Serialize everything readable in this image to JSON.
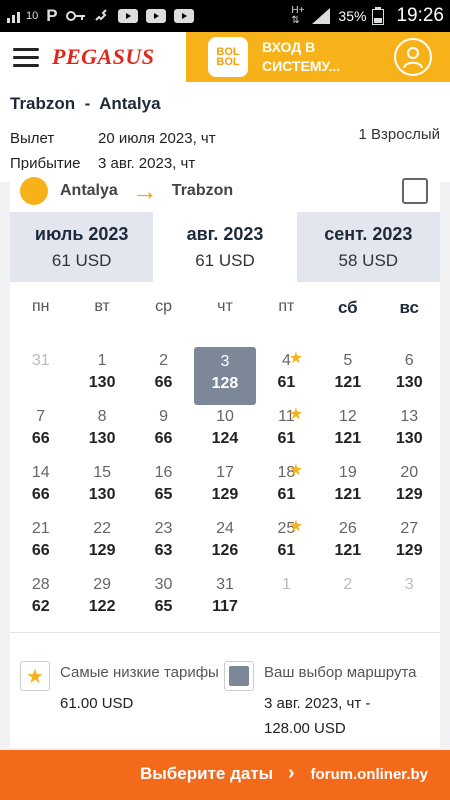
{
  "status_bar": {
    "left_icons": [
      "signal-10-icon",
      "p-icon",
      "key-icon",
      "call-icon",
      "youtube-icon",
      "youtube-icon",
      "youtube-icon"
    ],
    "signal_label": "10",
    "battery_pct": "35%",
    "time": "19:26"
  },
  "header": {
    "brand": "PEGASUS",
    "bolbol_line1": "BOL",
    "bolbol_line2": "BOL",
    "login_line1": "ВХОД В",
    "login_line2": "СИСТЕМУ..."
  },
  "trip": {
    "from": "Trabzon",
    "to": "Antalya",
    "dep_label": "Вылет",
    "dep_value": "20 июля 2023, чт",
    "arr_label": "Прибытие",
    "arr_value": "3 авг. 2023, чт",
    "passengers": "1 Взрослый"
  },
  "card_header": {
    "from": "Antalya",
    "to": "Trabzon"
  },
  "months": [
    {
      "name": "июль 2023",
      "price": "61 USD",
      "active": false
    },
    {
      "name": "авг. 2023",
      "price": "61 USD",
      "active": true
    },
    {
      "name": "сент. 2023",
      "price": "58 USD",
      "active": false
    }
  ],
  "weekdays": [
    "пн",
    "вт",
    "ср",
    "чт",
    "пт",
    "сб",
    "вс"
  ],
  "calendar": [
    [
      {
        "n": "31",
        "p": "",
        "muted": true
      },
      {
        "n": "1",
        "p": "130"
      },
      {
        "n": "2",
        "p": "66"
      },
      {
        "n": "3",
        "p": "128",
        "selected": true
      },
      {
        "n": "4",
        "p": "61",
        "star": true
      },
      {
        "n": "5",
        "p": "121"
      },
      {
        "n": "6",
        "p": "130"
      }
    ],
    [
      {
        "n": "7",
        "p": "66"
      },
      {
        "n": "8",
        "p": "130"
      },
      {
        "n": "9",
        "p": "66"
      },
      {
        "n": "10",
        "p": "124"
      },
      {
        "n": "11",
        "p": "61",
        "star": true
      },
      {
        "n": "12",
        "p": "121"
      },
      {
        "n": "13",
        "p": "130"
      }
    ],
    [
      {
        "n": "14",
        "p": "66"
      },
      {
        "n": "15",
        "p": "130"
      },
      {
        "n": "16",
        "p": "65"
      },
      {
        "n": "17",
        "p": "129"
      },
      {
        "n": "18",
        "p": "61",
        "star": true
      },
      {
        "n": "19",
        "p": "121"
      },
      {
        "n": "20",
        "p": "129"
      }
    ],
    [
      {
        "n": "21",
        "p": "66"
      },
      {
        "n": "22",
        "p": "129"
      },
      {
        "n": "23",
        "p": "63"
      },
      {
        "n": "24",
        "p": "126"
      },
      {
        "n": "25",
        "p": "61",
        "star": true
      },
      {
        "n": "26",
        "p": "121"
      },
      {
        "n": "27",
        "p": "129"
      }
    ],
    [
      {
        "n": "28",
        "p": "62"
      },
      {
        "n": "29",
        "p": "122"
      },
      {
        "n": "30",
        "p": "65"
      },
      {
        "n": "31",
        "p": "117"
      },
      {
        "n": "1",
        "p": "",
        "muted": true
      },
      {
        "n": "2",
        "p": "",
        "muted": true
      },
      {
        "n": "3",
        "p": "",
        "muted": true
      }
    ]
  ],
  "legend": {
    "lowest_label": "Самые низкие тарифы",
    "lowest_value": "61.00 USD",
    "choice_label": "Ваш выбор маршрута",
    "choice_value_line1": "3 авг. 2023, чт -",
    "choice_value_line2": "128.00 USD"
  },
  "bottom": {
    "cta": "Выберите даты",
    "watermark": "forum.onliner.by"
  },
  "colors": {
    "brand_red": "#e0261a",
    "bolbol_yellow": "#f7b21a",
    "cta_orange": "#f26a1a",
    "selected_day": "#7c8797"
  }
}
